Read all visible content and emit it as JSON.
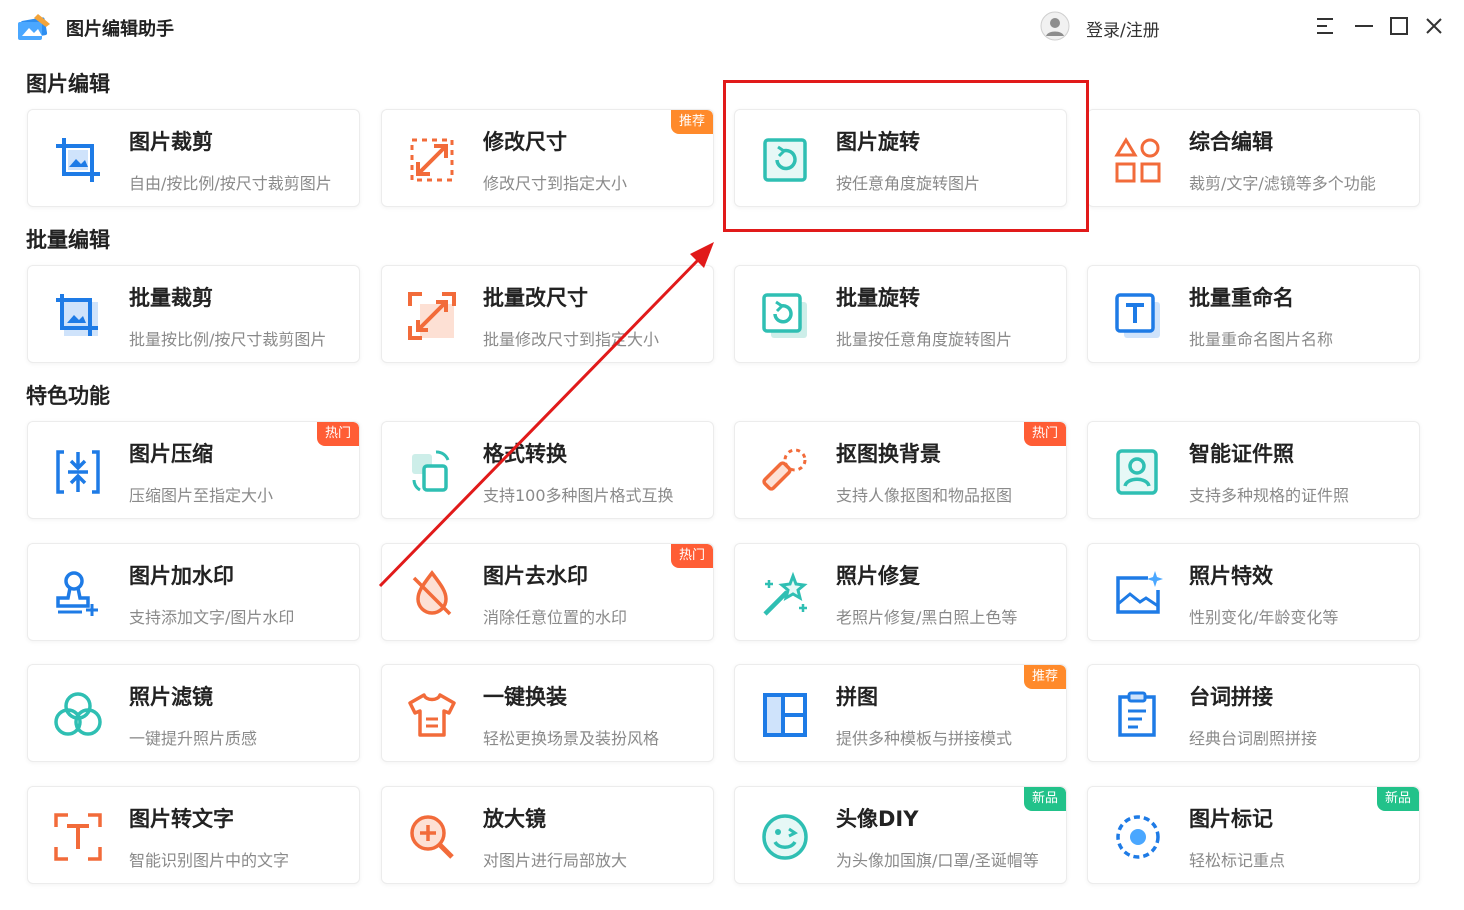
{
  "app": {
    "title": "图片编辑助手",
    "login_label": "登录/注册"
  },
  "sections": [
    {
      "title": "图片编辑"
    },
    {
      "title": "批量编辑"
    },
    {
      "title": "特色功能"
    }
  ],
  "cards": [
    {
      "name": "图片裁剪",
      "desc": "自由/按比例/按尺寸裁剪图片",
      "icon": "crop-icon"
    },
    {
      "name": "修改尺寸",
      "desc": "修改尺寸到指定大小",
      "icon": "resize-icon",
      "badge": "推荐"
    },
    {
      "name": "图片旋转",
      "desc": "按任意角度旋转图片",
      "icon": "rotate-icon"
    },
    {
      "name": "综合编辑",
      "desc": "裁剪/文字/滤镜等多个功能",
      "icon": "shapes-icon"
    },
    {
      "name": "批量裁剪",
      "desc": "批量按比例/按尺寸裁剪图片",
      "icon": "batch-crop-icon"
    },
    {
      "name": "批量改尺寸",
      "desc": "批量修改尺寸到指定大小",
      "icon": "batch-resize-icon"
    },
    {
      "name": "批量旋转",
      "desc": "批量按任意角度旋转图片",
      "icon": "batch-rotate-icon"
    },
    {
      "name": "批量重命名",
      "desc": "批量重命名图片名称",
      "icon": "rename-icon"
    },
    {
      "name": "图片压缩",
      "desc": "压缩图片至指定大小",
      "icon": "compress-icon",
      "badge": "热门"
    },
    {
      "name": "格式转换",
      "desc": "支持100多种图片格式互换",
      "icon": "convert-icon"
    },
    {
      "name": "抠图换背景",
      "desc": "支持人像抠图和物品抠图",
      "icon": "cutout-icon",
      "badge": "热门"
    },
    {
      "name": "智能证件照",
      "desc": "支持多种规格的证件照",
      "icon": "id-photo-icon"
    },
    {
      "name": "图片加水印",
      "desc": "支持添加文字/图片水印",
      "icon": "watermark-icon"
    },
    {
      "name": "图片去水印",
      "desc": "消除任意位置的水印",
      "icon": "remove-watermark-icon",
      "badge": "热门"
    },
    {
      "name": "照片修复",
      "desc": "老照片修复/黑白照上色等",
      "icon": "magic-wand-icon"
    },
    {
      "name": "照片特效",
      "desc": "性别变化/年龄变化等",
      "icon": "effects-icon"
    },
    {
      "name": "照片滤镜",
      "desc": "一键提升照片质感",
      "icon": "filter-icon"
    },
    {
      "name": "一键换装",
      "desc": "轻松更换场景及装扮风格",
      "icon": "shirt-icon"
    },
    {
      "name": "拼图",
      "desc": "提供多种模板与拼接模式",
      "icon": "collage-icon",
      "badge": "推荐"
    },
    {
      "name": "台词拼接",
      "desc": "经典台词剧照拼接",
      "icon": "clipboard-icon"
    },
    {
      "name": "图片转文字",
      "desc": "智能识别图片中的文字",
      "icon": "ocr-icon"
    },
    {
      "name": "放大镜",
      "desc": "对图片进行局部放大",
      "icon": "magnifier-icon"
    },
    {
      "name": "头像DIY",
      "desc": "为头像加国旗/口罩/圣诞帽等",
      "icon": "smiley-icon",
      "badge": "新品"
    },
    {
      "name": "图片标记",
      "desc": "轻松标记重点",
      "icon": "marker-icon",
      "badge": "新品"
    }
  ],
  "colors": {
    "blue": "#1e7be6",
    "orange": "#f26b3a",
    "teal": "#2fbfb3",
    "badge_orange": "#ff8a2b",
    "badge_red": "#ff5d35",
    "badge_green": "#22c28a",
    "highlight": "#e11a1a"
  }
}
